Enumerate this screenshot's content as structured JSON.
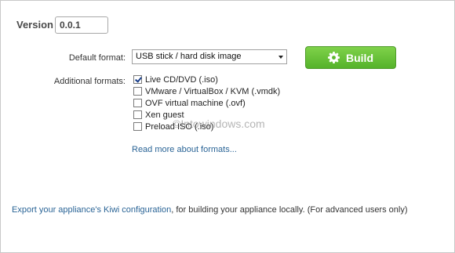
{
  "version": {
    "label": "Version",
    "value": "0.0.1"
  },
  "default_format": {
    "label": "Default format:",
    "selected": "USB stick / hard disk image"
  },
  "build_button": {
    "label": "Build",
    "icon": "gear-icon",
    "color": "#5cb82f"
  },
  "additional_formats": {
    "label": "Additional formats:",
    "items": [
      {
        "label": "Live CD/DVD (.iso)",
        "checked": true
      },
      {
        "label": "VMware / VirtualBox / KVM (.vmdk)",
        "checked": false
      },
      {
        "label": "OVF virtual machine (.ovf)",
        "checked": false
      },
      {
        "label": "Xen guest",
        "checked": false
      },
      {
        "label": "Preload ISO (.iso)",
        "checked": false
      }
    ]
  },
  "read_more": "Read more about formats...",
  "watermark": "©Intowindows.com",
  "footer": {
    "link_text": "Export your appliance's Kiwi configuration",
    "rest_text": ", for building your appliance locally. (For advanced users only)"
  }
}
